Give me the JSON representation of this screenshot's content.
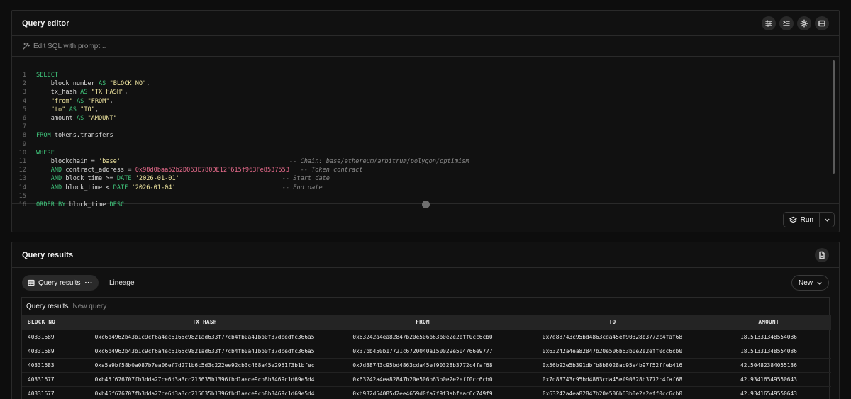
{
  "editor": {
    "title": "Query editor",
    "prompt_placeholder": "Edit SQL with prompt...",
    "run_label": "Run",
    "code_lines": [
      {
        "n": "1",
        "parts": [
          [
            "kw",
            "SELECT"
          ]
        ]
      },
      {
        "n": "2",
        "parts": [
          [
            "",
            "    block_number "
          ],
          [
            "kw",
            "AS"
          ],
          [
            "",
            " "
          ],
          [
            "str",
            "\"BLOCK NO\""
          ],
          [
            "",
            ","
          ]
        ]
      },
      {
        "n": "3",
        "parts": [
          [
            "",
            "    tx_hash "
          ],
          [
            "kw",
            "AS"
          ],
          [
            "",
            " "
          ],
          [
            "str",
            "\"TX HASH\""
          ],
          [
            "",
            ","
          ]
        ]
      },
      {
        "n": "4",
        "parts": [
          [
            "str",
            "    \"from\""
          ],
          [
            "",
            " "
          ],
          [
            "kw",
            "AS"
          ],
          [
            "",
            " "
          ],
          [
            "str",
            "\"FROM\""
          ],
          [
            "",
            ","
          ]
        ]
      },
      {
        "n": "5",
        "parts": [
          [
            "str",
            "    \"to\""
          ],
          [
            "",
            " "
          ],
          [
            "kw",
            "AS"
          ],
          [
            "",
            " "
          ],
          [
            "str",
            "\"TO\""
          ],
          [
            "",
            ","
          ]
        ]
      },
      {
        "n": "6",
        "parts": [
          [
            "",
            "    amount "
          ],
          [
            "kw",
            "AS"
          ],
          [
            "",
            " "
          ],
          [
            "str",
            "\"AMOUNT\""
          ]
        ]
      },
      {
        "n": "7",
        "parts": []
      },
      {
        "n": "8",
        "parts": [
          [
            "kw",
            "FROM"
          ],
          [
            "",
            " tokens.transfers"
          ]
        ]
      },
      {
        "n": "9",
        "parts": []
      },
      {
        "n": "10",
        "parts": [
          [
            "kw",
            "WHERE"
          ]
        ]
      },
      {
        "n": "11",
        "parts": [
          [
            "",
            "    blockchain = "
          ],
          [
            "str",
            "'base'"
          ],
          [
            "",
            "                                              "
          ],
          [
            "cm",
            "-- Chain: base/ethereum/arbitrum/polygon/optimism"
          ]
        ]
      },
      {
        "n": "12",
        "parts": [
          [
            "",
            "    "
          ],
          [
            "kw",
            "AND"
          ],
          [
            "",
            " contract_address = "
          ],
          [
            "hex",
            "0x98d0baa52b2D063E780DE12F615f963Fe8537553"
          ],
          [
            "",
            "   "
          ],
          [
            "cm",
            "-- Token contract"
          ]
        ]
      },
      {
        "n": "13",
        "parts": [
          [
            "",
            "    "
          ],
          [
            "kw",
            "AND"
          ],
          [
            "",
            " block_time >= "
          ],
          [
            "kw",
            "DATE"
          ],
          [
            "",
            " "
          ],
          [
            "str",
            "'2026-01-01'"
          ],
          [
            "",
            "                            "
          ],
          [
            "cm",
            "-- Start date"
          ]
        ]
      },
      {
        "n": "14",
        "parts": [
          [
            "",
            "    "
          ],
          [
            "kw",
            "AND"
          ],
          [
            "",
            " block_time < "
          ],
          [
            "kw",
            "DATE"
          ],
          [
            "",
            " "
          ],
          [
            "str",
            "'2026-01-04'"
          ],
          [
            "",
            "                             "
          ],
          [
            "cm",
            "-- End date"
          ]
        ]
      },
      {
        "n": "15",
        "parts": []
      },
      {
        "n": "16",
        "parts": [
          [
            "kw",
            "ORDER BY"
          ],
          [
            "",
            " block_time "
          ],
          [
            "kw",
            "DESC"
          ]
        ]
      }
    ]
  },
  "results": {
    "title": "Query results",
    "tab_active": "Query results",
    "tab_more": "···",
    "tab_lineage": "Lineage",
    "new_label": "New",
    "subtab_active": "Query results",
    "subtab_new": "New query",
    "columns": [
      "BLOCK NO",
      "TX HASH",
      "FROM",
      "TO",
      "AMOUNT"
    ],
    "rows": [
      [
        "40331689",
        "0xc6b4962b43b1c9cf6a4ec6165c9821ad633f77cb4fb0a41bb0f37dcedfc366a5",
        "0x63242a4ea82847b20e506b63b0e2e2eff0cc6cb0",
        "0x7d88743c95bd4863cda45ef90328b3772c4faf68",
        "18.51331348554086"
      ],
      [
        "40331689",
        "0xc6b4962b43b1c9cf6a4ec6165c9821ad633f77cb4fb0a41bb0f37dcedfc366a5",
        "0x37bb450b17721c6720040a150029e504766e9777",
        "0x63242a4ea82847b20e506b63b0e2e2eff0cc6cb0",
        "18.51331348554086"
      ],
      [
        "40331683",
        "0xa5a9bf58b0a087b7ea06ef7d271b6c5d3c222ee92cb3c468a45e2951f3b1bfec",
        "0x7d88743c95bd4863cda45ef90328b3772c4faf68",
        "0x56b92e5b391dbfb8b8028ac95a4b97f52ffeb416",
        "42.50482384055136"
      ],
      [
        "40331677",
        "0xb45f676707fb3dda27ce6d3a3cc215635b1396fbd1aece9cb8b3469c1d69e5d4",
        "0x63242a4ea82847b20e506b63b0e2e2eff0cc6cb0",
        "0x7d88743c95bd4863cda45ef90328b3772c4faf68",
        "42.93416549550643"
      ],
      [
        "40331677",
        "0xb45f676707fb3dda27ce6d3a3cc215635b1396fbd1aece9cb8b3469c1d69e5d4",
        "0xb932d54085d2ee4659d0fa7f9f3abfeac6c749f9",
        "0x63242a4ea82847b20e506b63b0e2e2eff0cc6cb0",
        "42.93416549550643"
      ]
    ]
  }
}
